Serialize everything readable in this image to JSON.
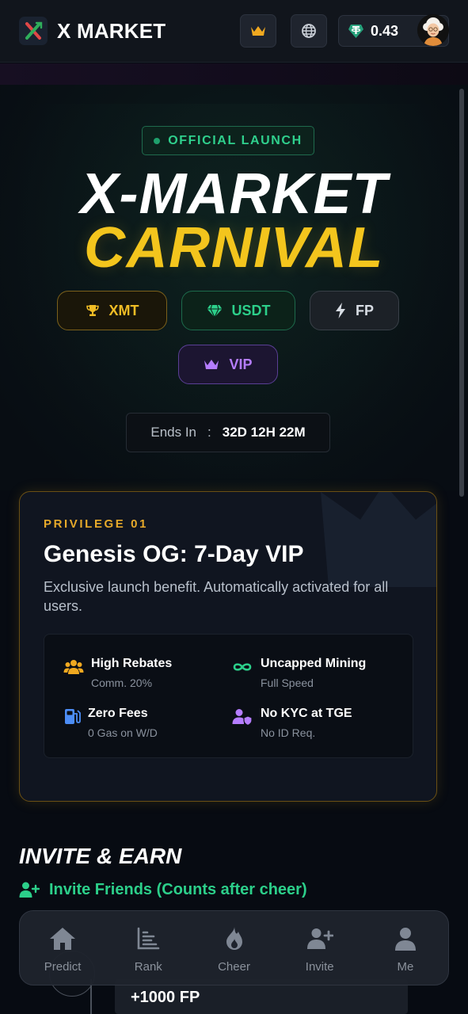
{
  "header": {
    "brand": "X MARKET",
    "balance": "0.43",
    "icons": [
      "x-market-logo-icon",
      "crown-icon",
      "globe-icon",
      "usdt-icon",
      "avatar"
    ]
  },
  "hero": {
    "badge": "OFFICIAL LAUNCH",
    "title_line1": "X-MARKET",
    "title_line2": "CARNIVAL",
    "chips": [
      {
        "label": "XMT",
        "icon": "trophy-icon",
        "color": "#f1bd25"
      },
      {
        "label": "USDT",
        "icon": "diamond-icon",
        "color": "#2ccf8a"
      },
      {
        "label": "FP",
        "icon": "bolt-icon",
        "color": "#d8dde4"
      },
      {
        "label": "VIP",
        "icon": "crown-icon",
        "color": "#b57dff"
      }
    ],
    "countdown_label": "Ends In",
    "countdown_sep": ":",
    "countdown_value": "32D 12H 22M"
  },
  "privilege": {
    "tag": "PRIVILEGE 01",
    "title": "Genesis OG: 7-Day VIP",
    "description": "Exclusive launch benefit. Automatically activated for all users.",
    "features": [
      {
        "title": "High Rebates",
        "subtitle": "Comm. 20%",
        "icon": "users-icon"
      },
      {
        "title": "Uncapped Mining",
        "subtitle": "Full Speed",
        "icon": "infinity-icon"
      },
      {
        "title": "Zero Fees",
        "subtitle": "0 Gas on W/D",
        "icon": "gas-pump-icon"
      },
      {
        "title": "No KYC at TGE",
        "subtitle": "No ID Req.",
        "icon": "user-shield-icon"
      }
    ]
  },
  "invite": {
    "heading": "INVITE & EARN",
    "subheading": "Invite Friends (Counts after cheer)",
    "reward": "+1000 FP"
  },
  "nav": {
    "items": [
      {
        "label": "Predict",
        "icon": "home-icon"
      },
      {
        "label": "Rank",
        "icon": "chart-icon"
      },
      {
        "label": "Cheer",
        "icon": "flame-icon"
      },
      {
        "label": "Invite",
        "icon": "user-plus-icon"
      },
      {
        "label": "Me",
        "icon": "user-icon"
      }
    ]
  },
  "colors": {
    "accent_green": "#2ccf8a",
    "accent_gold": "#f3c51d",
    "accent_purple": "#b57dff",
    "background": "#070b12"
  }
}
